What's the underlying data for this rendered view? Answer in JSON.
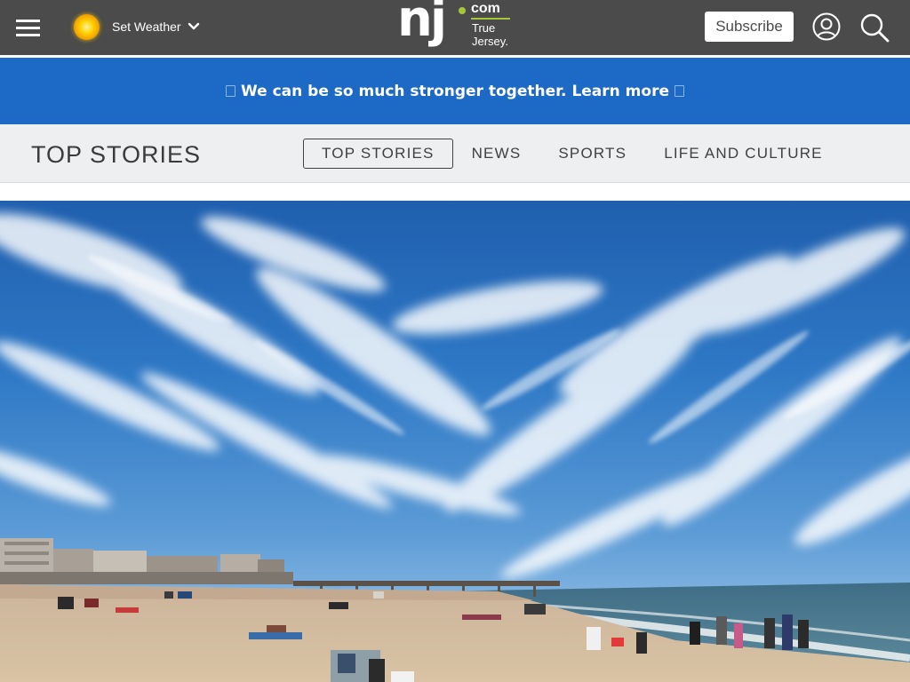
{
  "header": {
    "weather_label": "Set Weather",
    "logo": {
      "brand": "nj",
      "domain": "com",
      "tagline_line1": "True",
      "tagline_line2": "Jersey."
    },
    "subscribe_label": "Subscribe",
    "icons": {
      "menu": "hamburger-menu-icon",
      "weather": "sun-icon",
      "dropdown": "chevron-down-icon",
      "account": "account-icon",
      "search": "search-icon"
    }
  },
  "promo": {
    "text": "We can be so much stronger together. Learn more"
  },
  "section": {
    "title": "TOP STORIES",
    "tabs": [
      {
        "label": "TOP STORIES",
        "active": true
      },
      {
        "label": "NEWS",
        "active": false
      },
      {
        "label": "SPORTS",
        "active": false
      },
      {
        "label": "LIFE AND CULTURE",
        "active": false
      }
    ]
  },
  "colors": {
    "header_bg": "#4a4b4a",
    "promo_bg": "#1d6ac6",
    "nav_bg": "#eeeff1",
    "logo_accent": "#a4c639"
  },
  "hero": {
    "description_icon": "beach-photo"
  }
}
